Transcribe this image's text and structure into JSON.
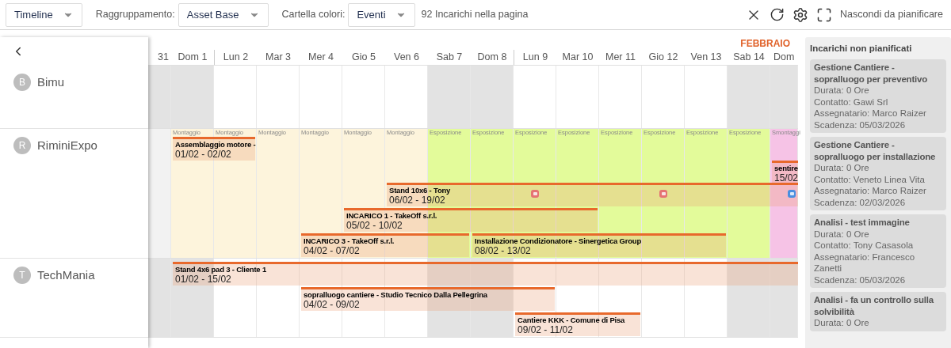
{
  "toolbar": {
    "view_select": "Timeline",
    "grouping_label": "Raggruppamento:",
    "grouping_select": "Asset Base",
    "color_label": "Cartella colori:",
    "color_select": "Eventi",
    "count": "92 Incarichi nella pagina",
    "hide_button": "Nascondi da pianificare"
  },
  "timeline": {
    "month": "FEBBRAIO",
    "days": [
      {
        "label": "31",
        "weekend": true,
        "week_start": false
      },
      {
        "label": "Dom 1",
        "weekend": true,
        "week_start": false
      },
      {
        "label": "Lun 2",
        "weekend": false,
        "week_start": true
      },
      {
        "label": "Mar 3",
        "weekend": false,
        "week_start": false
      },
      {
        "label": "Mer 4",
        "weekend": false,
        "week_start": false
      },
      {
        "label": "Gio 5",
        "weekend": false,
        "week_start": false
      },
      {
        "label": "Ven 6",
        "weekend": false,
        "week_start": false
      },
      {
        "label": "Sab 7",
        "weekend": true,
        "week_start": false
      },
      {
        "label": "Dom 8",
        "weekend": true,
        "week_start": false
      },
      {
        "label": "Lun 9",
        "weekend": false,
        "week_start": true
      },
      {
        "label": "Mar 10",
        "weekend": false,
        "week_start": false
      },
      {
        "label": "Mer 11",
        "weekend": false,
        "week_start": false
      },
      {
        "label": "Gio 12",
        "weekend": false,
        "week_start": false
      },
      {
        "label": "Ven 13",
        "weekend": false,
        "week_start": false
      },
      {
        "label": "Sab 14",
        "weekend": true,
        "week_start": false
      },
      {
        "label": "Dom",
        "weekend": true,
        "week_start": false
      }
    ],
    "resources": [
      {
        "initial": "B",
        "name": "Bimu"
      },
      {
        "initial": "R",
        "name": "RiminiExpo",
        "phases": [
          {
            "kind": "none"
          },
          {
            "kind": "montaggio",
            "label": "Montaggio"
          },
          {
            "kind": "montaggio",
            "label": "Montaggio"
          },
          {
            "kind": "montaggio",
            "label": "Montaggio"
          },
          {
            "kind": "montaggio",
            "label": "Montaggio"
          },
          {
            "kind": "montaggio",
            "label": "Montaggio"
          },
          {
            "kind": "montaggio",
            "label": "Montaggio"
          },
          {
            "kind": "esposizione",
            "label": "Esposizione"
          },
          {
            "kind": "esposizione",
            "label": "Esposizione"
          },
          {
            "kind": "esposizione",
            "label": "Esposizione"
          },
          {
            "kind": "esposizione",
            "label": "Esposizione"
          },
          {
            "kind": "esposizione",
            "label": "Esposizione"
          },
          {
            "kind": "esposizione",
            "label": "Esposizione"
          },
          {
            "kind": "esposizione",
            "label": "Esposizione"
          },
          {
            "kind": "esposizione",
            "label": "Esposizione"
          },
          {
            "kind": "smontaggio",
            "label": "Smontaggi"
          }
        ],
        "events": [
          {
            "title": "Assemblaggio motore -",
            "dates": "01/02 - 02/02"
          },
          {
            "title": "sentire",
            "dates": "15/02"
          },
          {
            "title": "Stand 10x6 - Tony",
            "dates": "06/02 - 19/02",
            "markers": [
              {
                "color": "#e57373"
              },
              {
                "color": "#e57373"
              },
              {
                "color": "#4a8fe0"
              }
            ]
          },
          {
            "title": "INCARICO 1 - TakeOff s.r.l.",
            "dates": "05/02 - 10/02"
          },
          {
            "title": "INCARICO 3 - TakeOff s.r.l.",
            "dates": "04/02 - 07/02"
          },
          {
            "title": "Installazione Condizionatore - Sinergetica Group",
            "dates": "08/02 - 13/02"
          }
        ]
      },
      {
        "initial": "T",
        "name": "TechMania",
        "events": [
          {
            "title": "Stand 4x6 pad 3 - Cliente 1",
            "dates": "01/02 - 15/02"
          },
          {
            "title": "sopralluogo cantiere - Studio Tecnico Dalla Pellegrina",
            "dates": "04/02 - 09/02"
          },
          {
            "title": "Cantiere KKK - Comune di Pisa",
            "dates": "09/02 - 11/02"
          }
        ]
      }
    ]
  },
  "unscheduled": {
    "title": "Incarichi non pianificati",
    "cards": [
      {
        "title": "Gestione Cantiere - sopralluogo per preventivo",
        "lines": [
          "Durata: 0 Ore",
          "Contatto: Gawi Srl",
          "Assegnatario: Marco Raizer",
          "Scadenza: 05/03/2026"
        ]
      },
      {
        "title": "Gestione Cantiere - sopralluogo per installazione",
        "lines": [
          "Durata: 0 Ore",
          "Contatto: Veneto Linea Vita",
          "Assegnatario: Marco Raizer",
          "Scadenza: 02/03/2026"
        ]
      },
      {
        "title": "Analisi - test immagine",
        "lines": [
          "Durata: 0 Ore",
          "Contatto: Tony Casasola",
          "Assegnatario: Francesco Zanetti",
          "Scadenza: 05/03/2026"
        ]
      },
      {
        "title": "Analisi - fa un controllo sulla solvibilità",
        "lines": [
          "Durata: 0 Ore"
        ]
      }
    ]
  }
}
